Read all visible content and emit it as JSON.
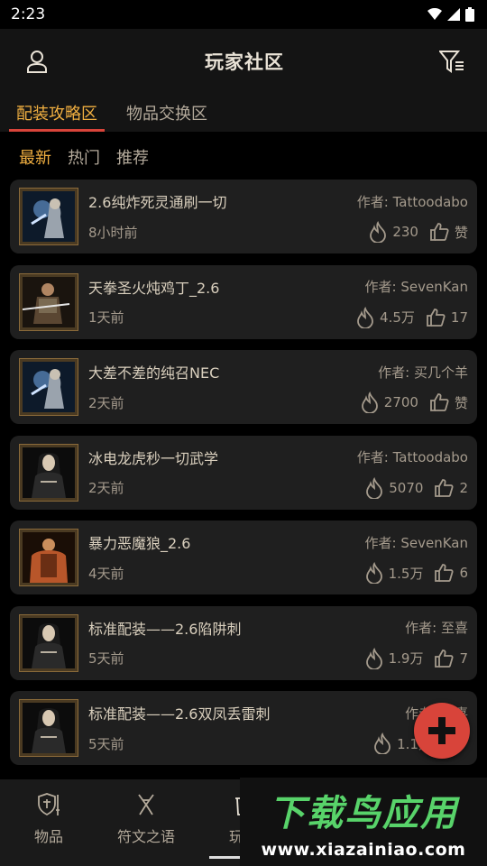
{
  "status": {
    "time": "2:23"
  },
  "header": {
    "title": "玩家社区"
  },
  "main_tabs": [
    {
      "label": "配装攻略区",
      "active": true
    },
    {
      "label": "物品交换区",
      "active": false
    }
  ],
  "sub_tabs": [
    {
      "label": "最新",
      "active": true
    },
    {
      "label": "热门",
      "active": false
    },
    {
      "label": "推荐",
      "active": false
    }
  ],
  "posts": [
    {
      "title": "2.6纯炸死灵通刷一切",
      "author": "作者: Tattoodabo",
      "time": "8小时前",
      "heat": "230",
      "likes": "赞",
      "avatar": "necro"
    },
    {
      "title": "天拳圣火炖鸡丁_2.6",
      "author": "作者: SevenKan",
      "time": "1天前",
      "heat": "4.5万",
      "likes": "17",
      "avatar": "paladin"
    },
    {
      "title": "大差不差的纯召NEC",
      "author": "作者: 买几个羊",
      "time": "2天前",
      "heat": "2700",
      "likes": "赞",
      "avatar": "necro"
    },
    {
      "title": "冰电龙虎秒一切武学",
      "author": "作者: Tattoodabo",
      "time": "2天前",
      "heat": "5070",
      "likes": "2",
      "avatar": "assassin"
    },
    {
      "title": "暴力恶魔狼_2.6",
      "author": "作者: SevenKan",
      "time": "4天前",
      "heat": "1.5万",
      "likes": "6",
      "avatar": "druid"
    },
    {
      "title": "标准配装——2.6陷阱刺",
      "author": "作者: 至喜",
      "time": "5天前",
      "heat": "1.9万",
      "likes": "7",
      "avatar": "assassin"
    },
    {
      "title": "标准配装——2.6双凤丢雷刺",
      "author": "作者: 至喜",
      "time": "5天前",
      "heat": "1.1万",
      "likes": "",
      "avatar": "assassin"
    }
  ],
  "bottom_nav": [
    {
      "label": "物品",
      "icon": "shield-sword-icon",
      "active": false
    },
    {
      "label": "符文之语",
      "icon": "rune-icon",
      "active": false
    },
    {
      "label": "玩家",
      "icon": "trash-icon",
      "active": true
    }
  ],
  "watermark": {
    "brand": "下载鸟应用",
    "url": "www.xiazainiao.com"
  },
  "colors": {
    "accent": "#f2b041",
    "danger": "#d8443a",
    "card": "#1f1f1f",
    "watermark_green": "#58d36a"
  }
}
